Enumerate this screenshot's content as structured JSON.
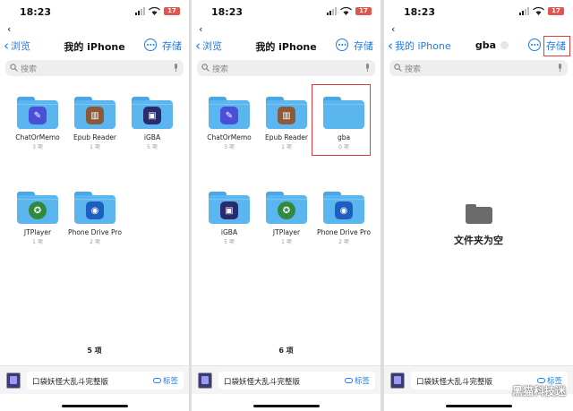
{
  "common": {
    "time": "18:23",
    "battery": "17",
    "back_label": "浏览",
    "search_placeholder": "搜索",
    "save_label": "存储",
    "bottom_file_name": "口袋妖怪大乱斗完整版",
    "tag_label": "标签",
    "accent_color": "#1a7cf5"
  },
  "panels": [
    {
      "title": "我的 iPhone",
      "items": [
        {
          "name": "ChatOrMemo",
          "count": "3 项",
          "icon": "mic-app-icon"
        },
        {
          "name": "Epub Reader",
          "count": "1 项",
          "icon": "book-app-icon"
        },
        {
          "name": "iGBA",
          "count": "5 项",
          "icon": "gameboy-app-icon"
        },
        {
          "name": "JTPlayer",
          "count": "1 项",
          "icon": "film-reel-app-icon"
        },
        {
          "name": "Phone Drive Pro",
          "count": "2 项",
          "icon": "wifi-drive-app-icon"
        }
      ],
      "total": "5 项"
    },
    {
      "title": "我的 iPhone",
      "items": [
        {
          "name": "ChatOrMemo",
          "count": "3 项",
          "icon": "mic-app-icon"
        },
        {
          "name": "Epub Reader",
          "count": "1 项",
          "icon": "book-app-icon"
        },
        {
          "name": "gba",
          "count": "0 项",
          "icon": ""
        },
        {
          "name": "iGBA",
          "count": "5 项",
          "icon": "gameboy-app-icon"
        },
        {
          "name": "JTPlayer",
          "count": "1 项",
          "icon": "film-reel-app-icon"
        },
        {
          "name": "Phone Drive Pro",
          "count": "2 项",
          "icon": "wifi-drive-app-icon"
        }
      ],
      "total": "6 项"
    },
    {
      "back_label": "我的 iPhone",
      "title": "gba",
      "empty_text": "文件夹为空"
    }
  ],
  "watermark": "黑猫科技迷"
}
